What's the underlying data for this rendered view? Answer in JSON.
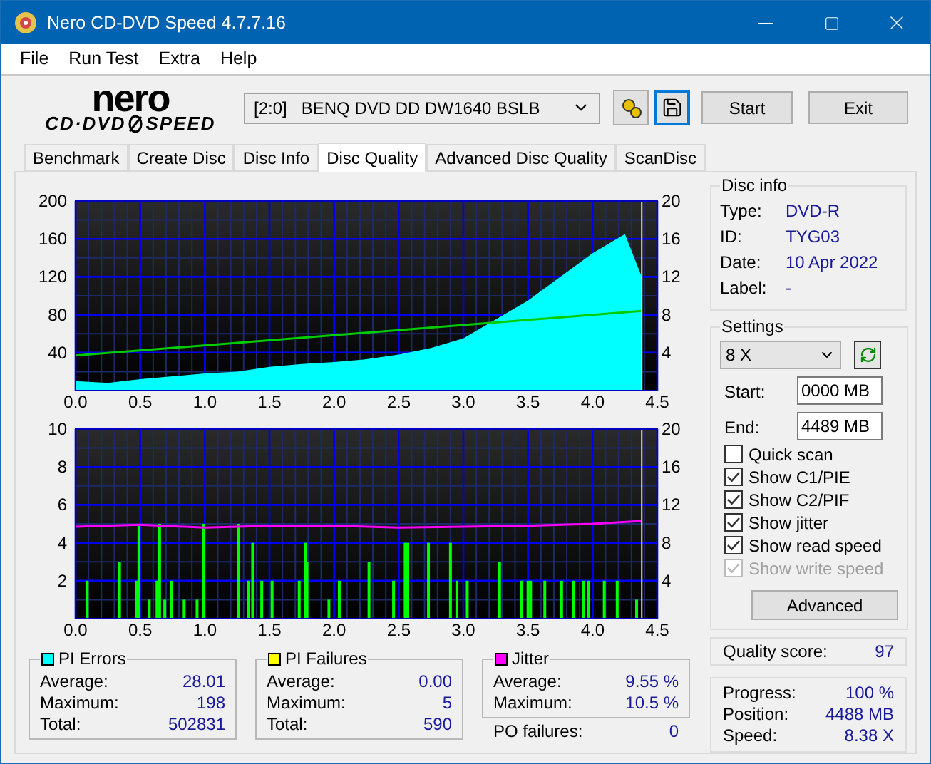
{
  "window": {
    "title": "Nero CD-DVD Speed 4.7.7.16"
  },
  "menu": [
    "File",
    "Run Test",
    "Extra",
    "Help"
  ],
  "logo": {
    "top": "nero",
    "left": "CD·DVD",
    "right": "SPEED"
  },
  "drive": {
    "value": "[2:0]   BENQ DVD DD DW1640 BSLB"
  },
  "toolbar_buttons": [
    "Start",
    "Exit"
  ],
  "tabs": [
    {
      "label": "Benchmark",
      "selected": false
    },
    {
      "label": "Create Disc",
      "selected": false
    },
    {
      "label": "Disc Info",
      "selected": false
    },
    {
      "label": "Disc Quality",
      "selected": true
    },
    {
      "label": "Advanced Disc Quality",
      "selected": false
    },
    {
      "label": "ScanDisc",
      "selected": false
    }
  ],
  "charts": [
    {
      "chart_data": {
        "type": "area",
        "grid": true,
        "ref_lines": [
          {
            "axis": "x",
            "value": 4.38,
            "color": "#e0e0e0"
          }
        ],
        "xlim": [
          0,
          4.5
        ],
        "ylim": [
          0,
          200
        ],
        "y2lim": [
          0,
          20
        ],
        "xticks": [
          {
            "value": 0,
            "label": "0.0"
          },
          {
            "value": 0.5,
            "label": "0.5"
          },
          {
            "value": 1,
            "label": "1.0"
          },
          {
            "value": 1.5,
            "label": "1.5"
          },
          {
            "value": 2,
            "label": "2.0"
          },
          {
            "value": 2.5,
            "label": "2.5"
          },
          {
            "value": 3,
            "label": "3.0"
          },
          {
            "value": 3.5,
            "label": "3.5"
          },
          {
            "value": 4,
            "label": "4.0"
          },
          {
            "value": 4.5,
            "label": "4.5"
          }
        ],
        "yticks": [
          40,
          80,
          120,
          160,
          200
        ],
        "y2ticks": [
          4,
          8,
          12,
          16,
          20
        ],
        "series": [
          {
            "color": "#00ffff",
            "x": [
              0,
              0.25,
              0.5,
              0.75,
              1,
              1.25,
              1.5,
              1.75,
              2,
              2.25,
              2.5,
              2.75,
              3,
              3.25,
              3.5,
              3.75,
              4,
              4.25,
              4.38
            ],
            "values": [
              10,
              8,
              12,
              15,
              18,
              20,
              25,
              28,
              30,
              33,
              38,
              45,
              55,
              75,
              95,
              120,
              145,
              165,
              120
            ]
          },
          {
            "type": "line",
            "axis": "y2",
            "color": "#00cc00",
            "x": [
              0,
              4.38
            ],
            "values": [
              3.7,
              8.4
            ]
          }
        ]
      }
    },
    {
      "chart_data": {
        "type": "bar",
        "grid": true,
        "ref_lines": [
          {
            "axis": "x",
            "value": 4.38,
            "color": "#e0e0e0"
          }
        ],
        "xlim": [
          0,
          4.5
        ],
        "ylim": [
          0,
          10
        ],
        "y2lim": [
          0,
          20
        ],
        "xticks": [
          {
            "value": 0,
            "label": "0.0"
          },
          {
            "value": 0.5,
            "label": "0.5"
          },
          {
            "value": 1,
            "label": "1.0"
          },
          {
            "value": 1.5,
            "label": "1.5"
          },
          {
            "value": 2,
            "label": "2.0"
          },
          {
            "value": 2.5,
            "label": "2.5"
          },
          {
            "value": 3,
            "label": "3.0"
          },
          {
            "value": 3.5,
            "label": "3.5"
          },
          {
            "value": 4,
            "label": "4.0"
          },
          {
            "value": 4.5,
            "label": "4.5"
          }
        ],
        "yticks": [
          2,
          4,
          6,
          8,
          10
        ],
        "y2ticks": [
          4,
          8,
          12,
          16,
          20
        ],
        "series": [
          {
            "color": "#00ff00",
            "x": [
              0.09,
              0.34,
              0.47,
              0.49,
              0.57,
              0.63,
              0.65,
              0.69,
              0.74,
              0.84,
              0.94,
              0.99,
              1.26,
              1.34,
              1.37,
              1.44,
              1.52,
              1.73,
              1.78,
              1.79,
              1.96,
              2.04,
              2.27,
              2.46,
              2.55,
              2.57,
              2.73,
              2.9,
              2.95,
              3.03,
              3.28,
              3.45,
              3.5,
              3.52,
              3.63,
              3.76,
              3.85,
              3.93,
              3.97,
              4.09,
              4.19,
              4.34
            ],
            "values": [
              2,
              3,
              2,
              5,
              1,
              2,
              5,
              1,
              2,
              1,
              1,
              5,
              5,
              2,
              4,
              2,
              2,
              2,
              4,
              3,
              1,
              2,
              3,
              2,
              4,
              4,
              4,
              4,
              2,
              2,
              3,
              2,
              2,
              2,
              2,
              2,
              2,
              2,
              2,
              2,
              2,
              1
            ]
          },
          {
            "type": "line",
            "axis": "y2",
            "color": "#ff00ff",
            "x": [
              0,
              0.5,
              1,
              1.5,
              2,
              2.5,
              3,
              3.5,
              4,
              4.38
            ],
            "values": [
              9.7,
              9.9,
              9.6,
              9.8,
              9.8,
              9.6,
              9.7,
              9.8,
              10,
              10.3
            ]
          }
        ]
      }
    }
  ],
  "disc_info": {
    "title": "Disc info",
    "rows": [
      {
        "label": "Type:",
        "value": "DVD-R"
      },
      {
        "label": "ID:",
        "value": "TYG03"
      },
      {
        "label": "Date:",
        "value": "10 Apr 2022"
      },
      {
        "label": "Label:",
        "value": "-"
      }
    ]
  },
  "settings": {
    "title": "Settings",
    "speed": "8 X",
    "start": {
      "label": "Start:",
      "value": "0000 MB"
    },
    "end": {
      "label": "End:",
      "value": "4489 MB"
    },
    "options": [
      {
        "label": "Quick scan",
        "checked": false,
        "disabled": false
      },
      {
        "label": "Show C1/PIE",
        "checked": true,
        "disabled": false
      },
      {
        "label": "Show C2/PIF",
        "checked": true,
        "disabled": false
      },
      {
        "label": "Show jitter",
        "checked": true,
        "disabled": false
      },
      {
        "label": "Show read speed",
        "checked": true,
        "disabled": false
      },
      {
        "label": "Show write speed",
        "checked": true,
        "disabled": true
      }
    ],
    "advanced": "Advanced"
  },
  "quality": {
    "label": "Quality score:",
    "value": "97"
  },
  "stats": [
    {
      "title": "PI Errors",
      "color": "#00ffff",
      "rows": [
        {
          "label": "Average:",
          "value": "28.01"
        },
        {
          "label": "Maximum:",
          "value": "198"
        },
        {
          "label": "Total:",
          "value": "502831"
        }
      ]
    },
    {
      "title": "PI Failures",
      "color": "#ffff00",
      "rows": [
        {
          "label": "Average:",
          "value": "0.00"
        },
        {
          "label": "Maximum:",
          "value": "5"
        },
        {
          "label": "Total:",
          "value": "590"
        }
      ]
    },
    {
      "title": "Jitter",
      "color": "#ff00ff",
      "rows": [
        {
          "label": "Average:",
          "value": "9.55 %"
        },
        {
          "label": "Maximum:",
          "value": "10.5 %"
        }
      ]
    }
  ],
  "po_failures": {
    "label": "PO failures:",
    "value": "0"
  },
  "progress": [
    {
      "label": "Progress:",
      "value": "100 %"
    },
    {
      "label": "Position:",
      "value": "4488 MB"
    },
    {
      "label": "Speed:",
      "value": "8.38 X"
    }
  ]
}
